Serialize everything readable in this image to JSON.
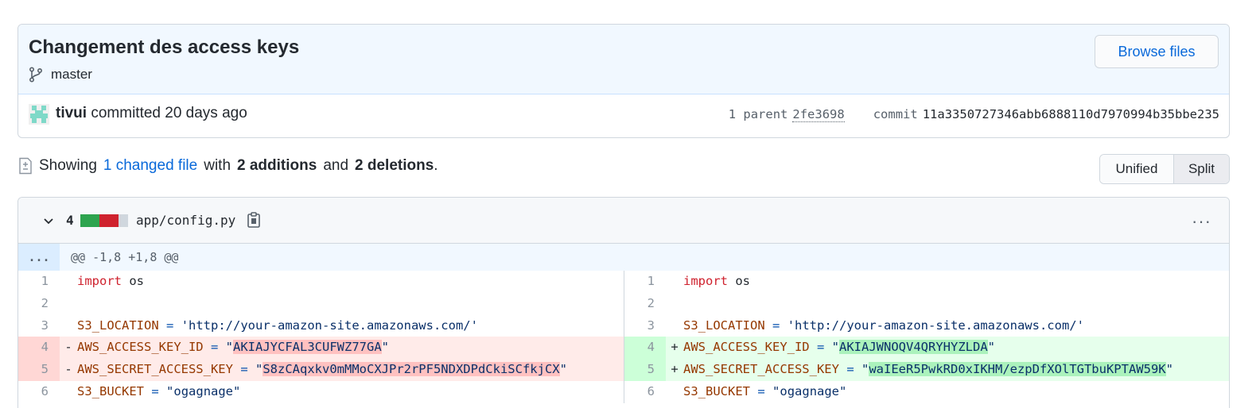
{
  "commit": {
    "title": "Changement des access keys",
    "branch": "master",
    "browse_files_label": "Browse files",
    "author": "tivui",
    "committed_text": "committed 20 days ago",
    "parent_label": "1 parent",
    "parent_sha": "2fe3698",
    "commit_label": "commit",
    "commit_sha": "11a3350727346abb6888110d7970994b35bbe235"
  },
  "summary": {
    "showing": "Showing",
    "changed_files": "1 changed file",
    "with": "with",
    "additions": "2 additions",
    "and": "and",
    "deletions": "2 deletions",
    "period": "."
  },
  "view_toggle": {
    "unified": "Unified",
    "split": "Split",
    "selected": "Split"
  },
  "file": {
    "change_count": "4",
    "diffstat": [
      "added",
      "added",
      "deleted",
      "deleted",
      "neutral"
    ],
    "name": "app/config.py",
    "more_label": "···",
    "hunk_expand": "...",
    "hunk_header": "@@ -1,8 +1,8 @@",
    "left": {
      "lines": [
        {
          "num": "1",
          "mark": "",
          "type": "ctx"
        },
        {
          "num": "2",
          "mark": "",
          "type": "ctx"
        },
        {
          "num": "3",
          "mark": "",
          "type": "ctx"
        },
        {
          "num": "4",
          "mark": "-",
          "type": "del"
        },
        {
          "num": "5",
          "mark": "-",
          "type": "del"
        },
        {
          "num": "6",
          "mark": "",
          "type": "ctx"
        }
      ]
    },
    "right": {
      "lines": [
        {
          "num": "1",
          "mark": "",
          "type": "ctx"
        },
        {
          "num": "2",
          "mark": "",
          "type": "ctx"
        },
        {
          "num": "3",
          "mark": "",
          "type": "ctx"
        },
        {
          "num": "4",
          "mark": "+",
          "type": "add"
        },
        {
          "num": "5",
          "mark": "+",
          "type": "add"
        },
        {
          "num": "6",
          "mark": "",
          "type": "ctx"
        }
      ]
    },
    "code": {
      "import_kw": "import",
      "import_mod": "os",
      "s3_location_var": "S3_LOCATION",
      "eq": "=",
      "s3_location_val": "'http://your-amazon-site.amazonaws.com/'",
      "access_key_var": "AWS_ACCESS_KEY_ID",
      "secret_key_var": "AWS_SECRET_ACCESS_KEY",
      "quote": "\"",
      "old_access_key": "AKIAJYCFAL3CUFWZ77GA",
      "old_secret_key": "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",
      "new_access_key": "AKIAJWNOQV4QRYHYZLDA",
      "new_secret_key": "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",
      "s3_bucket_var": "S3_BUCKET",
      "s3_bucket_val": "\"ogagnage\""
    }
  },
  "colors": {
    "link": "#0969da",
    "added": "#2da44e",
    "deleted": "#cf222e",
    "neutral": "#d0d7de"
  }
}
